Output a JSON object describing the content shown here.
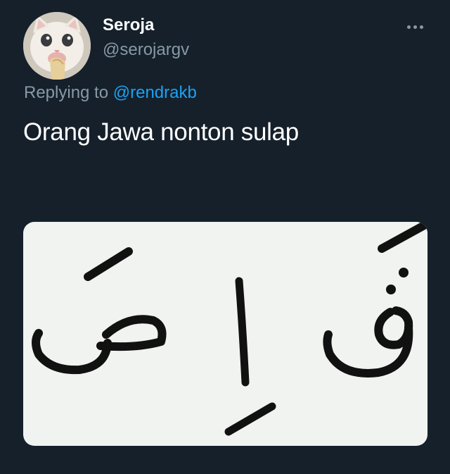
{
  "tweet": {
    "display_name": "Seroja",
    "handle": "@serojargv",
    "replying_prefix": "Replying to",
    "replying_to": "@rendrakb",
    "text": "Orang Jawa nonton sulap",
    "more_icon": "more-horizontal-icon"
  },
  "media": {
    "letters": [
      "قَ",
      "اِ",
      "صَ"
    ]
  },
  "colors": {
    "background": "#15202b",
    "text_primary": "#ffffff",
    "text_secondary": "#8899a6",
    "link": "#1da1f2",
    "media_background": "#f1f3f0"
  }
}
